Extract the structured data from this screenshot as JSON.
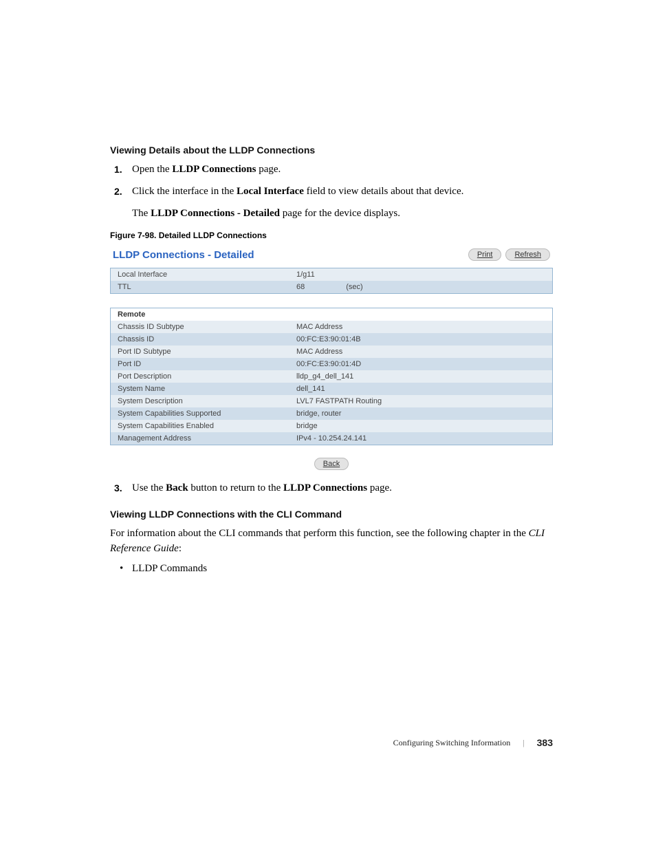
{
  "section1_heading": "Viewing Details about the LLDP Connections",
  "step1": {
    "num": "1.",
    "pre": "Open the ",
    "bold": "LLDP Connections",
    "post": " page."
  },
  "step2": {
    "num": "2.",
    "pre": "Click the interface in the ",
    "bold": "Local Interface",
    "post": " field to view details about that device.",
    "line2_pre": "The ",
    "line2_bold": "LLDP Connections - Detailed",
    "line2_post": " page for the device displays."
  },
  "figure_label": "Figure 7-98.    Detailed LLDP Connections",
  "shot": {
    "title": "LLDP Connections - Detailed",
    "print": "Print",
    "refresh": "Refresh",
    "top_rows": [
      {
        "lbl": "Local Interface",
        "val": "1/g11"
      },
      {
        "lbl": "TTL",
        "val": "68",
        "unit": "(sec)"
      }
    ],
    "remote_heading": "Remote",
    "remote_rows": [
      {
        "lbl": "Chassis ID Subtype",
        "val": "MAC Address"
      },
      {
        "lbl": "Chassis ID",
        "val": "00:FC:E3:90:01:4B"
      },
      {
        "lbl": "Port ID Subtype",
        "val": "MAC Address"
      },
      {
        "lbl": "Port ID",
        "val": "00:FC:E3:90:01:4D"
      },
      {
        "lbl": "Port Description",
        "val": "lldp_g4_dell_141"
      },
      {
        "lbl": "System Name",
        "val": "dell_141"
      },
      {
        "lbl": "System Description",
        "val": "LVL7 FASTPATH Routing"
      },
      {
        "lbl": "System Capabilities Supported",
        "val": "bridge, router"
      },
      {
        "lbl": "System Capabilities Enabled",
        "val": "bridge"
      },
      {
        "lbl": "Management Address",
        "val": "IPv4 - 10.254.24.141"
      }
    ],
    "back": "Back"
  },
  "step3": {
    "num": "3.",
    "pre": "Use the ",
    "bold1": "Back",
    "mid": " button to return to the ",
    "bold2": "LLDP Connections",
    "post": " page."
  },
  "section2_heading": "Viewing LLDP Connections with the CLI Command",
  "para_pre": "For information about the CLI commands that perform this function, see the following chapter in the ",
  "para_ital": "CLI Reference Guide",
  "para_post": ":",
  "bullet1": "LLDP Commands",
  "footer_text": "Configuring Switching Information",
  "page_number": "383"
}
